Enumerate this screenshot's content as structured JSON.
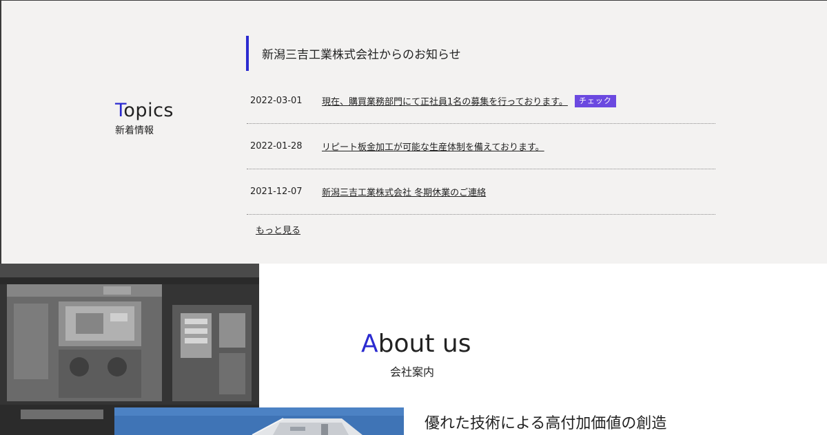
{
  "topics": {
    "title_accent": "T",
    "title_rest": "opics",
    "subtitle": "新着情報",
    "notice_header": "新潟三吉工業株式会社からのお知らせ",
    "news": [
      {
        "date": "2022-03-01",
        "title": "現在、購買業務部門にて正社員1名の募集を行っております。",
        "badge": "チェック"
      },
      {
        "date": "2022-01-28",
        "title": "リピート板金加工が可能な生産体制を備えております。"
      },
      {
        "date": "2021-12-07",
        "title": "新潟三吉工業株式会社 冬期休業のご連絡"
      }
    ],
    "more_label": "もっと見る"
  },
  "about": {
    "title_accent": "A",
    "title_rest": "bout us",
    "subtitle": "会社案内",
    "tagline": "優れた技術による高付加価値の創造"
  },
  "colors": {
    "accent": "#2b2bd0",
    "badge": "#6b49e0",
    "topics_bg": "#f3f2f1"
  }
}
